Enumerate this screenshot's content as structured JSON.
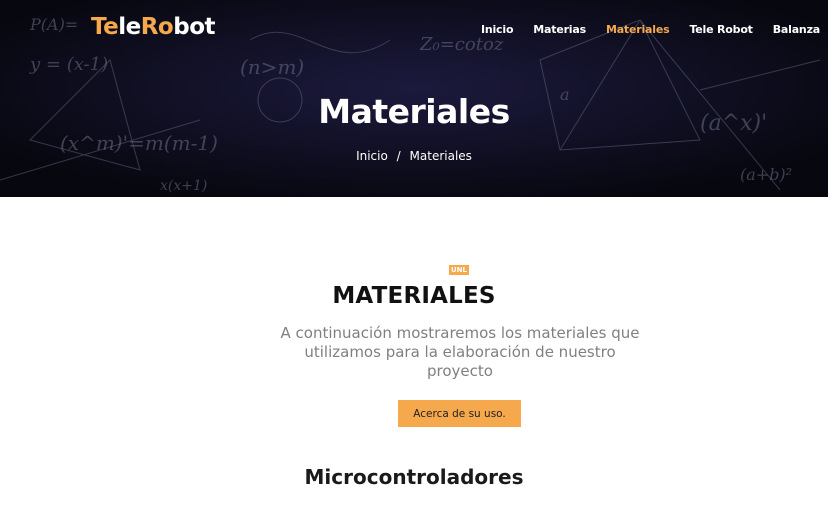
{
  "brand": {
    "part1": "Te",
    "part2": "le",
    "part3": "Ro",
    "part4": "bot"
  },
  "nav": {
    "items": [
      {
        "label": "Inicio"
      },
      {
        "label": "Materias"
      },
      {
        "label": "Materiales"
      },
      {
        "label": "Tele Robot"
      },
      {
        "label": "Balanza"
      }
    ],
    "active": "Materiales"
  },
  "hero": {
    "title": "Materiales",
    "breadcrumb": {
      "home": "Inicio",
      "separator": "/",
      "current": "Materiales"
    }
  },
  "section": {
    "badge": "UNL",
    "title": "MATERIALES",
    "lead": "A continuación mostraremos los materiales que utilizamos para la elaboración de nuestro proyecto",
    "cta_label": "Acerca de su uso.",
    "subtitle": "Microcontroladores"
  },
  "colors": {
    "accent": "#f5a84c",
    "hero_bg": "#0d0c1c",
    "text_dark": "#111111",
    "text_muted": "#808080"
  }
}
